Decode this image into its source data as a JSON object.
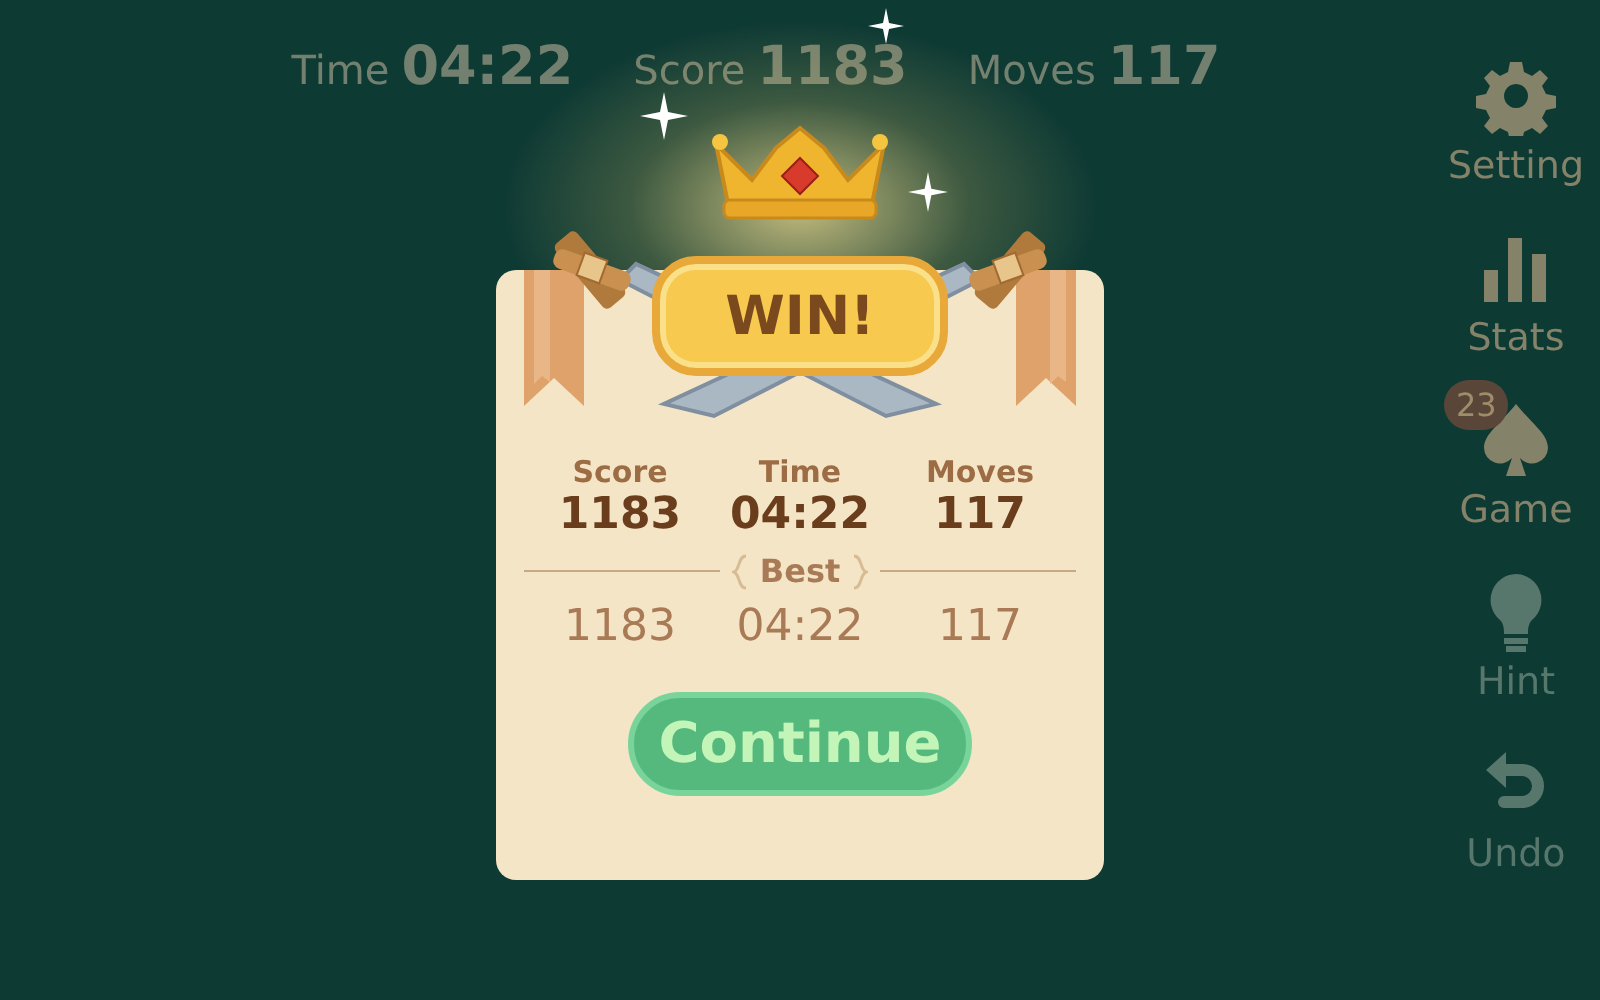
{
  "hud": [
    {
      "label": "Time",
      "value": "04:22"
    },
    {
      "label": "Score",
      "value": "1183"
    },
    {
      "label": "Moves",
      "value": "117"
    }
  ],
  "sidebar": [
    {
      "kind": "gear",
      "label": "Setting",
      "disabled": false
    },
    {
      "kind": "bars",
      "label": "Stats",
      "disabled": false
    },
    {
      "kind": "spade",
      "label": "Game",
      "badge": "23",
      "disabled": false
    },
    {
      "kind": "bulb",
      "label": "Hint",
      "disabled": true
    },
    {
      "kind": "undo",
      "label": "Undo",
      "disabled": true
    }
  ],
  "dialog": {
    "title": "WIN!",
    "best_label": "Best",
    "button": "Continue",
    "stats": [
      {
        "label": "Score",
        "value": "1183",
        "best": "1183"
      },
      {
        "label": "Time",
        "value": "04:22",
        "best": "04:22"
      },
      {
        "label": "Moves",
        "value": "117",
        "best": "117"
      }
    ]
  }
}
